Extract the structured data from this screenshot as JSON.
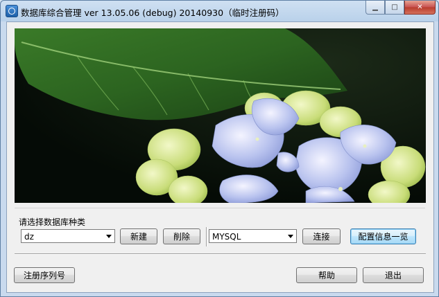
{
  "window": {
    "title": "数据库综合管理 ver 13.05.06 (debug) 20140930（临时注册码）",
    "minimize_glyph": "▁",
    "maximize_glyph": "□",
    "close_glyph": "✕"
  },
  "banner": {
    "subject": "hydrangea-flower-photo"
  },
  "db_group": {
    "label": "请选择数据库种类",
    "db_name_select": "dz",
    "new_button": "新建",
    "delete_button": "削除",
    "db_type_select": "MYSQL",
    "connect_button": "连接",
    "config_button": "配置信息一览"
  },
  "footer": {
    "register_button": "注册序列号",
    "help_button": "帮助",
    "exit_button": "退出"
  }
}
